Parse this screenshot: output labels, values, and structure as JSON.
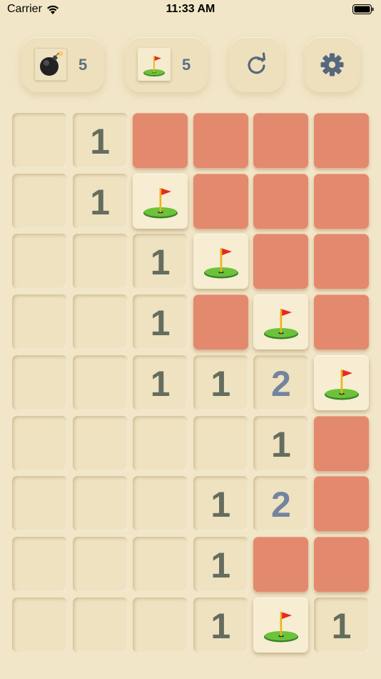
{
  "status": {
    "carrier": "Carrier",
    "time": "11:33 AM"
  },
  "hud": {
    "bombs": {
      "icon": "bomb-icon",
      "count": "5"
    },
    "flags": {
      "icon": "flag-icon",
      "count": "5"
    },
    "restart": {
      "icon": "restart-icon"
    },
    "settings": {
      "icon": "gear-icon"
    }
  },
  "colors": {
    "background": "#f1e6c7",
    "hidden_tile": "#e3896d",
    "revealed_tile": "#efe2c1",
    "number_1": "#656d5e",
    "number_2": "#73849e"
  },
  "board": {
    "columns": 6,
    "rows": 9,
    "legend": "E = empty revealed, H = hidden, F = flagged, digit = adjacent mine count",
    "grid": [
      [
        "E",
        "1",
        "H",
        "H",
        "H",
        "H"
      ],
      [
        "E",
        "1",
        "F",
        "H",
        "H",
        "H"
      ],
      [
        "E",
        "E",
        "1",
        "F",
        "H",
        "H"
      ],
      [
        "E",
        "E",
        "1",
        "H",
        "F",
        "H"
      ],
      [
        "E",
        "E",
        "1",
        "1",
        "2",
        "F"
      ],
      [
        "E",
        "E",
        "E",
        "E",
        "1",
        "H"
      ],
      [
        "E",
        "E",
        "E",
        "1",
        "2",
        "H"
      ],
      [
        "E",
        "E",
        "E",
        "1",
        "H",
        "H"
      ],
      [
        "E",
        "E",
        "E",
        "1",
        "F",
        "1"
      ]
    ]
  }
}
